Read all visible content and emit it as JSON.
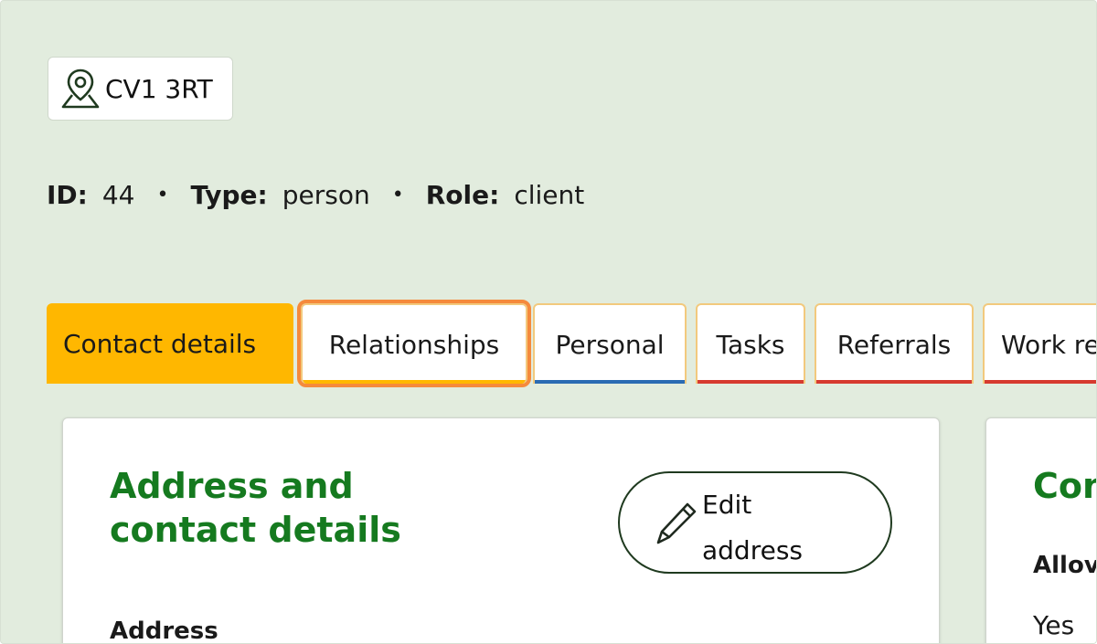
{
  "postcode": {
    "icon": "map-pin-icon",
    "text": "CV1 3RT"
  },
  "meta": {
    "id_label": "ID:",
    "id_value": "44",
    "type_label": "Type:",
    "type_value": "person",
    "role_label": "Role:",
    "role_value": "client",
    "separator": "•"
  },
  "tabs": [
    {
      "label": "Contact details",
      "state": "active",
      "accent": "#ffb700"
    },
    {
      "label": "Relationships",
      "state": "focused",
      "accent": "#ffb700"
    },
    {
      "label": "Personal",
      "accent": "#2a6bb3"
    },
    {
      "label": "Tasks",
      "accent": "#d63a2f"
    },
    {
      "label": "Referrals",
      "accent": "#d63a2f"
    },
    {
      "label": "Work re",
      "accent": "#d63a2f"
    }
  ],
  "address_card": {
    "title_line1": "Address and",
    "title_line2": "contact details",
    "edit_button": {
      "icon": "pencil-icon",
      "line1": "Edit",
      "line2": "address"
    },
    "address_label": "Address"
  },
  "contact_card": {
    "title": "Con",
    "field_label": "Allov",
    "field_value": "Yes"
  },
  "colors": {
    "background": "#e2ecde",
    "title_green": "#157a1f",
    "active_tab": "#ffb700",
    "focus_ring": "#f58a3c"
  }
}
